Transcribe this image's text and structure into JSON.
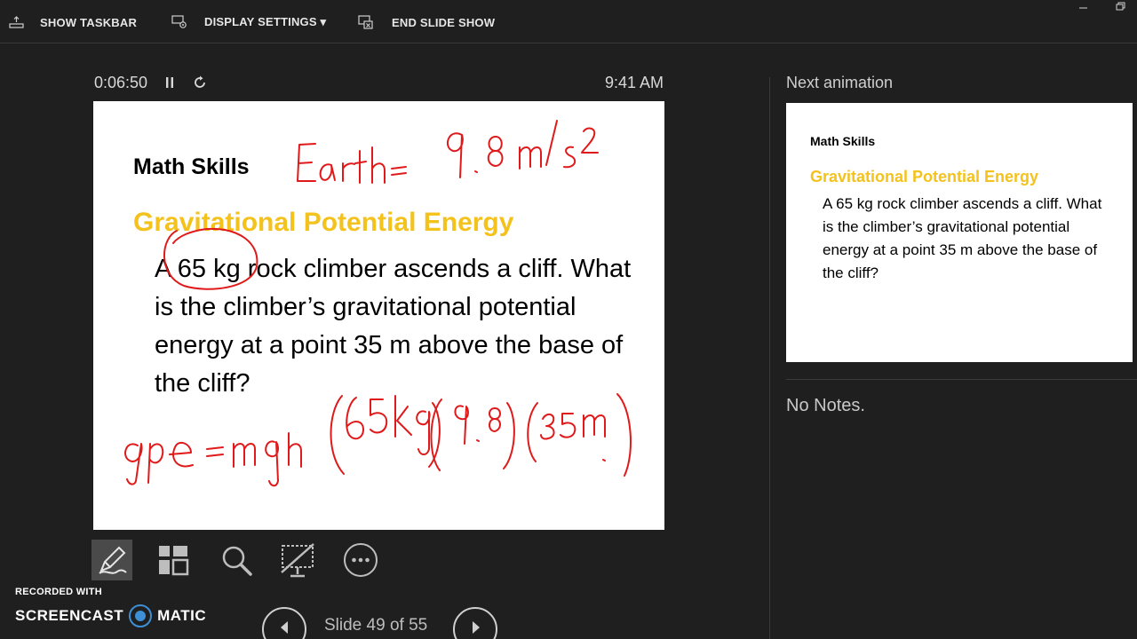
{
  "topbar": {
    "show_taskbar": "SHOW TASKBAR",
    "display_settings": "DISPLAY SETTINGS ▾",
    "end_slide_show": "END SLIDE SHOW"
  },
  "presenter": {
    "timer": "0:06:50",
    "clock": "9:41 AM"
  },
  "current_slide": {
    "heading": "Math Skills",
    "title": "Gravitational Potential Energy",
    "body": "A 65 kg rock climber ascends a cliff. What is the climber’s gravitational potential energy at a point 35 m above the base of the cliff?"
  },
  "navigation": {
    "slide_counter": "Slide 49 of 55"
  },
  "next_pane": {
    "label": "Next animation",
    "heading": "Math Skills",
    "title": "Gravitational Potential Energy",
    "body": "A 65 kg rock climber ascends a cliff. What is the climber’s gravitational potential energy at a point 35 m above the base of the cliff?"
  },
  "notes": {
    "text": "No Notes."
  },
  "watermark": {
    "line1": "RECORDED WITH",
    "left": "SCREENCAST",
    "right": "MATIC"
  },
  "colors": {
    "accent_title": "#f4c21c",
    "ink": "#e01a1a",
    "background": "#1f1f1f",
    "screencast_blue": "#3d8fd6"
  }
}
